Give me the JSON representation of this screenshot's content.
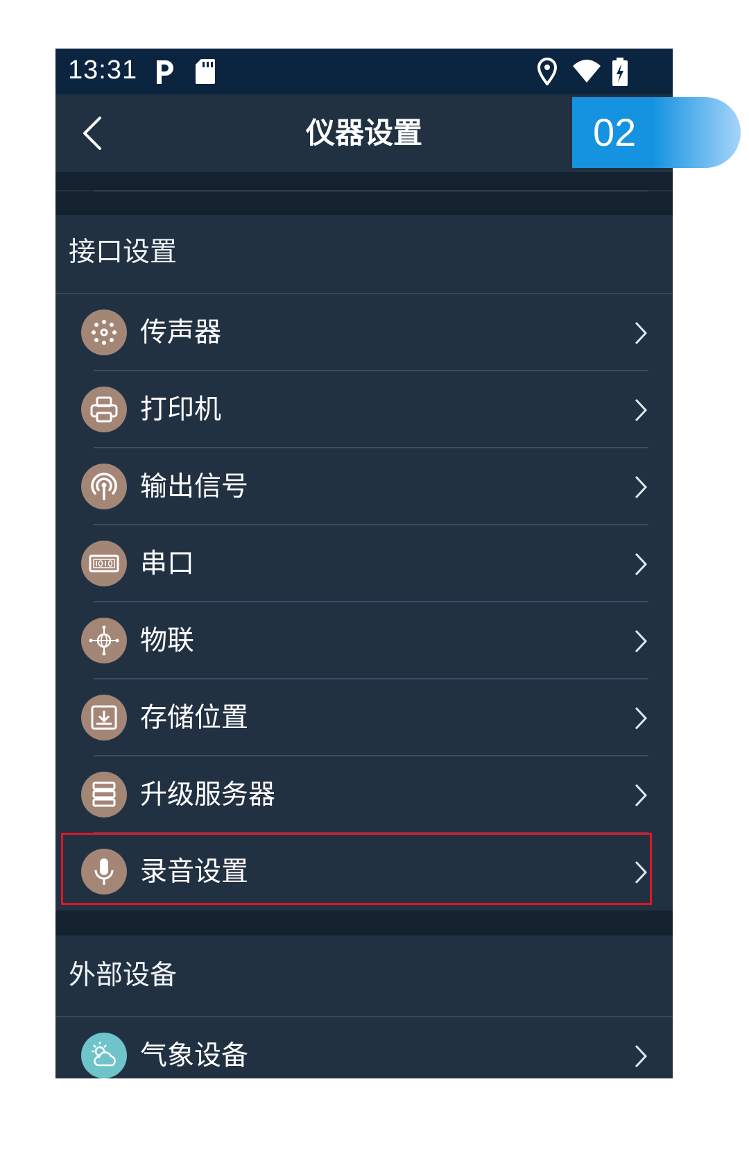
{
  "status_bar": {
    "time": "13:31",
    "left_icons": [
      "parking-icon",
      "sd-card-icon"
    ],
    "right_icons": [
      "location-icon",
      "wifi-icon",
      "battery-charging-icon"
    ]
  },
  "header": {
    "title": "仪器设置",
    "back_icon": "chevron-left-icon"
  },
  "step_badge": "02",
  "sections": [
    {
      "title": "接口设置",
      "items": [
        {
          "label": "传声器",
          "icon": "microphone-array-icon"
        },
        {
          "label": "打印机",
          "icon": "printer-icon"
        },
        {
          "label": "输出信号",
          "icon": "signal-broadcast-icon"
        },
        {
          "label": "串口",
          "icon": "serial-port-icon"
        },
        {
          "label": "物联",
          "icon": "iot-globe-icon"
        },
        {
          "label": "存储位置",
          "icon": "storage-download-icon"
        },
        {
          "label": "升级服务器",
          "icon": "server-icon"
        },
        {
          "label": "录音设置",
          "icon": "microphone-icon",
          "highlighted": true
        }
      ]
    },
    {
      "title": "外部设备",
      "items": [
        {
          "label": "气象设备",
          "icon": "weather-icon"
        }
      ]
    }
  ],
  "colors": {
    "background": "#213142",
    "status_bar": "#0b2440",
    "icon_circle": "#a48677",
    "weather_icon_circle": "#6ec4c9",
    "highlight_border": "#e21622",
    "badge_blue": "#1593e0"
  }
}
